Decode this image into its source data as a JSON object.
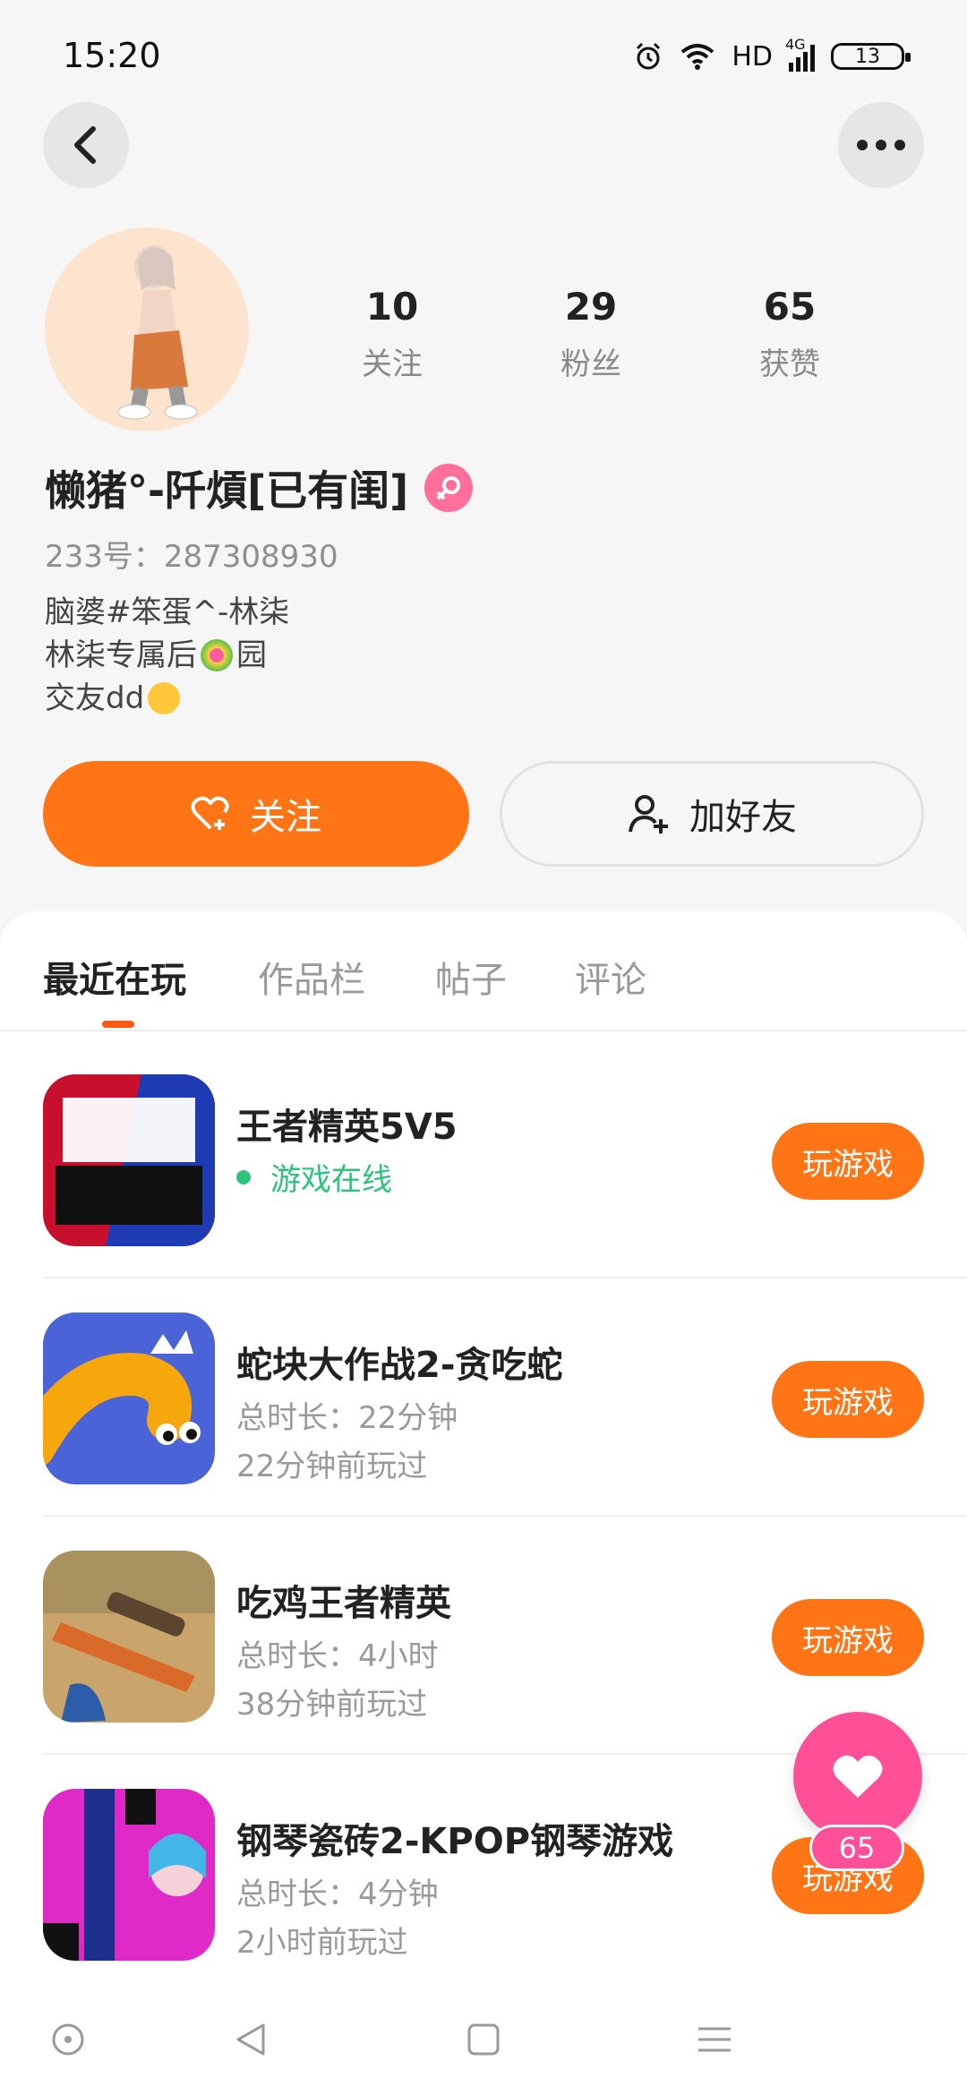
{
  "status_bar": {
    "time": "15:20",
    "network": "HD",
    "signal_label": "4G",
    "battery": "13"
  },
  "profile": {
    "username": "懒猪°-阡熕[已有闺]",
    "id_text": "233号：287308930",
    "bio": {
      "line1": "脑婆#笨蛋^-林柒",
      "line2_a": "林柒专属后",
      "line2_b": "园",
      "line3": "交友dd"
    },
    "stats": [
      {
        "num": "10",
        "label": "关注"
      },
      {
        "num": "29",
        "label": "粉丝"
      },
      {
        "num": "65",
        "label": "获赞"
      }
    ]
  },
  "actions": {
    "follow": "关注",
    "add_friend": "加好友"
  },
  "tabs": [
    "最近在玩",
    "作品栏",
    "帖子",
    "评论"
  ],
  "games": [
    {
      "title": "王者精英5V5",
      "status": "游戏在线",
      "play": "玩游戏"
    },
    {
      "title": "蛇块大作战2-贪吃蛇",
      "duration": "总时长：22分钟",
      "last": "22分钟前玩过",
      "play": "玩游戏"
    },
    {
      "title": "吃鸡王者精英",
      "duration": "总时长：4小时",
      "last": "38分钟前玩过",
      "play": "玩游戏"
    },
    {
      "title": "钢琴瓷砖2-KPOP钢琴游戏",
      "duration": "总时长：4分钟",
      "last": "2小时前玩过",
      "play": "玩游戏"
    }
  ],
  "fab": {
    "count": "65"
  },
  "colors": {
    "accent": "#ff7415",
    "online": "#2cc47a",
    "like": "#ff4f97"
  }
}
